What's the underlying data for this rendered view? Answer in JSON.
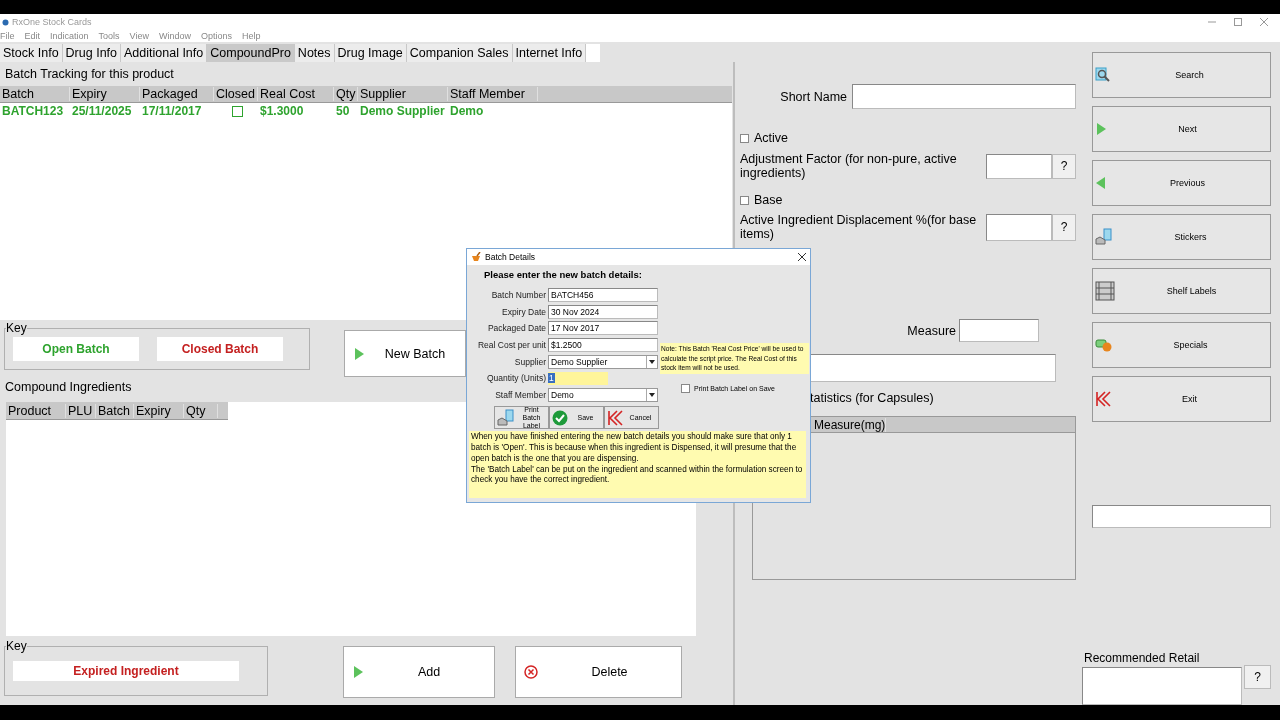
{
  "window": {
    "title": "RxOne Stock Cards"
  },
  "menu": [
    "File",
    "Edit",
    "Indication",
    "Tools",
    "View",
    "Window",
    "Options",
    "Help"
  ],
  "tabs": [
    {
      "label": "Stock Info",
      "selected": false
    },
    {
      "label": "Drug Info",
      "selected": false
    },
    {
      "label": "Additional Info",
      "selected": false
    },
    {
      "label": "CompoundPro",
      "selected": true
    },
    {
      "label": "Notes",
      "selected": false
    },
    {
      "label": "Drug Image",
      "selected": false
    },
    {
      "label": "Companion Sales",
      "selected": false
    },
    {
      "label": "Internet Info",
      "selected": false
    }
  ],
  "batch_tracking": {
    "title": "Batch Tracking for this product",
    "columns": [
      "Batch",
      "Expiry",
      "Packaged",
      "Closed",
      "Real Cost",
      "Qty",
      "Supplier",
      "Staff Member"
    ],
    "rows": [
      {
        "batch": "BATCH123",
        "expiry": "25/11/2025",
        "packaged": "17/11/2017",
        "closed": false,
        "real_cost": "$1.3000",
        "qty": "50",
        "supplier": "Demo Supplier",
        "staff_member": "Demo"
      }
    ]
  },
  "batch_key": {
    "title": "Key",
    "items": [
      {
        "label": "Open Batch",
        "color": "#2ea32e"
      },
      {
        "label": "Closed Batch",
        "color": "#c42020"
      }
    ]
  },
  "new_batch_button": "New Batch",
  "compound_ingredients": {
    "title": "Compound Ingredients",
    "columns": [
      "Product",
      "PLU",
      "Batch",
      "Expiry",
      "Qty"
    ]
  },
  "ingredient_key": {
    "title": "Key",
    "items": [
      {
        "label": "Expired Ingredient",
        "color": "#c42020"
      }
    ]
  },
  "ingredient_buttons": [
    {
      "label": "Add",
      "kind": "add"
    },
    {
      "label": "Delete",
      "kind": "delete"
    }
  ],
  "details": {
    "short_name_label": "Short Name",
    "active": {
      "label": "Active",
      "checked": false
    },
    "adjustment_factor": {
      "label": "Adjustment Factor (for non-pure, active ingredients)",
      "help": "?"
    },
    "base": {
      "label": "Base",
      "checked": false
    },
    "displacement": {
      "label": "Active Ingredient Displacement %(for base items)",
      "help": "?"
    },
    "measure_label": "Measure",
    "statistics_title": "tatistics (for Capsules)",
    "statistics_columns": [
      "Measure(mg)"
    ]
  },
  "side_buttons": [
    {
      "label": "Search",
      "kind": "search"
    },
    {
      "label": "Next",
      "kind": "next"
    },
    {
      "label": "Previous",
      "kind": "previous"
    },
    {
      "label": "Stickers",
      "kind": "stickers"
    },
    {
      "label": "Shelf Labels",
      "kind": "shelf"
    },
    {
      "label": "Specials",
      "kind": "specials"
    },
    {
      "label": "Exit",
      "kind": "exit"
    }
  ],
  "recommended_retail": {
    "label": "Recommended Retail",
    "help": "?"
  },
  "dialog": {
    "title": "Batch Details",
    "heading": "Please enter the new batch details:",
    "fields": [
      {
        "label": "Batch Number",
        "value": "BATCH456",
        "kind": "text"
      },
      {
        "label": "Expiry Date",
        "value": "30 Nov 2024",
        "kind": "text"
      },
      {
        "label": "Packaged Date",
        "value": "17 Nov 2017",
        "kind": "text"
      },
      {
        "label": "Real Cost per unit",
        "value": "$1.2500",
        "kind": "text"
      },
      {
        "label": "Supplier",
        "value": "Demo Supplier",
        "kind": "select"
      },
      {
        "label": "Quantity (Units)",
        "value": "1",
        "kind": "focused"
      },
      {
        "label": "Staff Member",
        "value": "Demo",
        "kind": "select"
      }
    ],
    "note": "Note: This Batch 'Real Cost Price' will be used to calculate the script price. The Real Cost of this stock item will not be used.",
    "print_on_save": {
      "label": "Print Batch Label on Save",
      "checked": false
    },
    "buttons": [
      {
        "label": "Print Batch Label",
        "kind": "print"
      },
      {
        "label": "Save",
        "kind": "save"
      },
      {
        "label": "Cancel",
        "kind": "cancel"
      }
    ],
    "info": [
      "When you have finished entering the new batch details you should make sure that only 1 batch is 'Open'. This is because when this ingredient is Dispensed, it will presume that the open batch is the one that you are dispensing.",
      "The 'Batch Label' can be put on the ingredient and scanned within the formulation screen to check you have the correct ingredient."
    ]
  }
}
